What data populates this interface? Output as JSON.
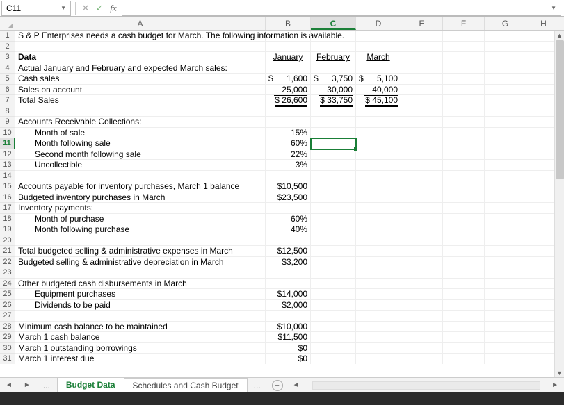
{
  "formula_bar": {
    "cell_ref": "C11",
    "formula": ""
  },
  "columns": [
    "A",
    "B",
    "C",
    "D",
    "E",
    "F",
    "G",
    "H"
  ],
  "active_col": "C",
  "active_row": 11,
  "rows": [
    {
      "n": 1,
      "A": "S & P Enterprises needs a cash budget for March. The following information is available."
    },
    {
      "n": 2
    },
    {
      "n": 3,
      "A": "Data",
      "A_class": "bold",
      "B": "January",
      "B_class": "underline center",
      "C": "February",
      "C_class": "underline center",
      "D": "March",
      "D_class": "underline center"
    },
    {
      "n": 4,
      "A": "Actual January and February and expected March sales:"
    },
    {
      "n": 5,
      "A": "Cash sales",
      "B_d": "$",
      "B": "1,600",
      "C_d": "$",
      "C": "3,750",
      "D_d": "$",
      "D": "5,100"
    },
    {
      "n": 6,
      "A": "Sales on account",
      "B_u": "25,000",
      "C_u": "30,000",
      "D_u": "40,000"
    },
    {
      "n": 7,
      "A": "Total Sales",
      "B_du": "$   26,600",
      "C_du": "$   33,750",
      "D_du": "$   45,100"
    },
    {
      "n": 8
    },
    {
      "n": 9,
      "A": "Accounts Receivable Collections:"
    },
    {
      "n": 10,
      "A": "Month of sale",
      "A_class": "indent1",
      "B": "15%"
    },
    {
      "n": 11,
      "A": "Month following sale",
      "A_class": "indent1",
      "B": "60%",
      "C_selected": true
    },
    {
      "n": 12,
      "A": "Second month following sale",
      "A_class": "indent1",
      "B": "22%"
    },
    {
      "n": 13,
      "A": "Uncollectible",
      "A_class": "indent1",
      "B": "3%"
    },
    {
      "n": 14
    },
    {
      "n": 15,
      "A": "Accounts payable for inventory purchases, March 1 balance",
      "B": "$10,500"
    },
    {
      "n": 16,
      "A": "Budgeted inventory purchases in March",
      "B": "$23,500"
    },
    {
      "n": 17,
      "A": "Inventory payments:"
    },
    {
      "n": 18,
      "A": "Month of purchase",
      "A_class": "indent1",
      "B": "60%"
    },
    {
      "n": 19,
      "A": "Month following purchase",
      "A_class": "indent1",
      "B": "40%"
    },
    {
      "n": 20
    },
    {
      "n": 21,
      "A": "Total budgeted selling & administrative expenses in March",
      "B": "$12,500"
    },
    {
      "n": 22,
      "A": "Budgeted selling & administrative depreciation in March",
      "B": "$3,200"
    },
    {
      "n": 23
    },
    {
      "n": 24,
      "A": "Other budgeted cash disbursements in March"
    },
    {
      "n": 25,
      "A": "Equipment purchases",
      "A_class": "indent1",
      "B": "$14,000"
    },
    {
      "n": 26,
      "A": "Dividends to be paid",
      "A_class": "indent1",
      "B": "$2,000"
    },
    {
      "n": 27
    },
    {
      "n": 28,
      "A": "Minimum cash balance to be maintained",
      "B": "$10,000"
    },
    {
      "n": 29,
      "A": "March 1 cash balance",
      "B": "$11,500"
    },
    {
      "n": 30,
      "A": "March 1 outstanding borrowings",
      "B": "$0"
    },
    {
      "n": 31,
      "A": "March 1 interest due",
      "B": "$0"
    }
  ],
  "tabs": {
    "active": "Budget Data",
    "other": "Schedules and Cash Budget",
    "more": "..."
  }
}
